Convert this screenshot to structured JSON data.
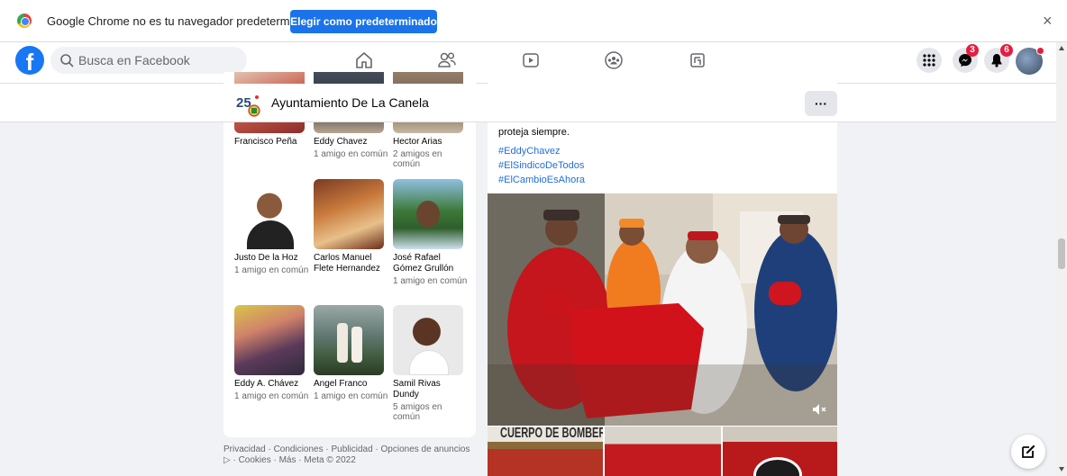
{
  "infobar": {
    "message": "Google Chrome no es tu navegador predeterminado",
    "button_label": "Elegir como predeterminado",
    "close_glyph": "×"
  },
  "topnav": {
    "logo_glyph": "f",
    "search_placeholder": "Busca en Facebook",
    "nav_icons": [
      "home-icon",
      "friends-icon",
      "watch-icon",
      "groups-icon",
      "gaming-icon"
    ],
    "right_icons": [
      "menu-grid-icon",
      "messenger-icon",
      "notifications-icon",
      "account-avatar"
    ],
    "messenger_badge": "3",
    "notifications_badge": "6"
  },
  "page": {
    "name": "Ayuntamiento De La Canela",
    "more_glyph": "···"
  },
  "friends": [
    {
      "name": "Francisco Peña",
      "mutual": ""
    },
    {
      "name": "Eddy Chavez",
      "mutual": "1 amigo en común"
    },
    {
      "name": "Hector Arias",
      "mutual": "2 amigos en común"
    },
    {
      "name": "Justo De la Hoz",
      "mutual": "1 amigo en común"
    },
    {
      "name": "Carlos Manuel Flete Hernandez",
      "mutual": ""
    },
    {
      "name": "José Rafael Gómez Grullón",
      "mutual": "1 amigo en común"
    },
    {
      "name": "Eddy A. Chávez",
      "mutual": "1 amigo en común"
    },
    {
      "name": "Angel Franco",
      "mutual": "1 amigo en común"
    },
    {
      "name": "Samil Rivas Dundy",
      "mutual": "5 amigos en común"
    }
  ],
  "footer": {
    "line1": "Privacidad · Condiciones · Publicidad · Opciones de anuncios",
    "line2": "▷ · Cookies · Más · Meta © 2022"
  },
  "post": {
    "text": "proteja siempre.",
    "hashtags": [
      "#EddyChavez",
      "#ElSindicoDeTodos",
      "#ElCambioEsAhora"
    ],
    "thumb_sign": "CUERPO DE BOMBEROS"
  },
  "colors": {
    "facebook_blue": "#1877f2",
    "chrome_button": "#1a73e8",
    "badge_red": "#e41e3f",
    "link_blue": "#216fdb"
  }
}
